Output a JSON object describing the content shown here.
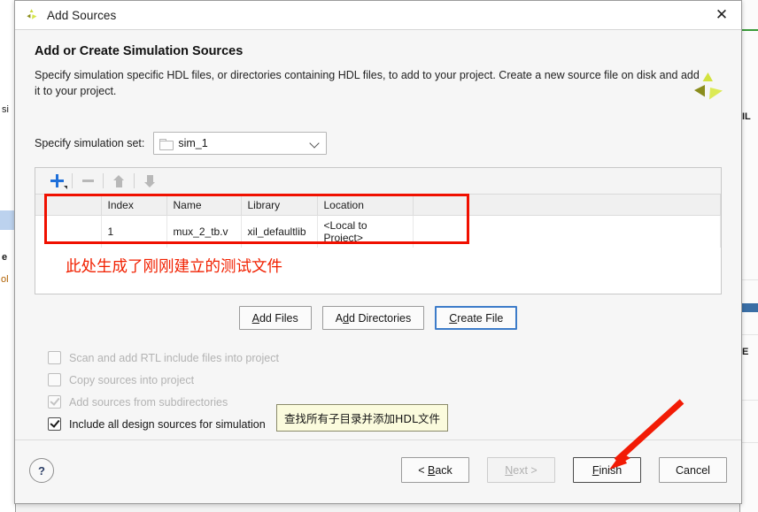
{
  "window": {
    "title": "Add Sources",
    "app_icon": "vivado-logo-icon",
    "close_label": "✕"
  },
  "header": {
    "title": "Add or Create Simulation Sources",
    "description": "Specify simulation specific HDL files, or directories containing HDL files, to add to your project. Create a new source file on disk and add it to your project.",
    "logo_icon": "vivado-logo-icon"
  },
  "simulation_set": {
    "label": "Specify simulation set:",
    "value": "sim_1",
    "icon": "folder-icon",
    "chevron": "chevron-down-icon"
  },
  "file_panel": {
    "toolbar": {
      "add": "+",
      "add_icon": "plus-icon",
      "remove_icon": "minus-icon",
      "move_up_icon": "arrow-up-icon",
      "move_down_icon": "arrow-down-icon"
    },
    "columns": [
      "",
      "Index",
      "Name",
      "Library",
      "Location",
      ""
    ],
    "rows": [
      {
        "status_icon": "status-dot-icon",
        "index": "1",
        "name": "mux_2_tb.v",
        "library": "xil_defaultlib",
        "location": "<Local to Project>"
      }
    ]
  },
  "annotations": {
    "table_note": "此处生成了刚刚建立的测试文件",
    "tooltip": "查找所有子目录并添加HDL文件",
    "highlight_color": "#f01000",
    "note_color": "#f12000",
    "arrow_color": "#f21b05"
  },
  "action_buttons": [
    {
      "label": "Add Files",
      "mnemonic_index": 0,
      "state": "normal"
    },
    {
      "label": "Add Directories",
      "mnemonic_index": 2,
      "state": "normal"
    },
    {
      "label": "Create File",
      "mnemonic_index": 0,
      "state": "focused"
    }
  ],
  "options": [
    {
      "label": "Scan and add RTL include files into project",
      "checked": false,
      "enabled": false,
      "mnemonic_index": 17
    },
    {
      "label": "Copy sources into project",
      "checked": false,
      "enabled": false,
      "mnemonic_index": 5
    },
    {
      "label": "Add sources from subdirectories",
      "checked": true,
      "enabled": false,
      "mnemonic_index": 9
    },
    {
      "label": "Include all design sources for simulation",
      "checked": true,
      "enabled": true,
      "mnemonic_index": 21
    }
  ],
  "footer": {
    "help_label": "?",
    "buttons": [
      {
        "label": "< Back",
        "state": "normal"
      },
      {
        "label": "Next >",
        "state": "disabled"
      },
      {
        "label": "Finish",
        "state": "default"
      },
      {
        "label": "Cancel",
        "state": "normal"
      }
    ]
  },
  "background": {
    "left_fragments": [
      "si",
      "e",
      "ol"
    ],
    "right_fragments": [
      "IL",
      "E"
    ]
  }
}
